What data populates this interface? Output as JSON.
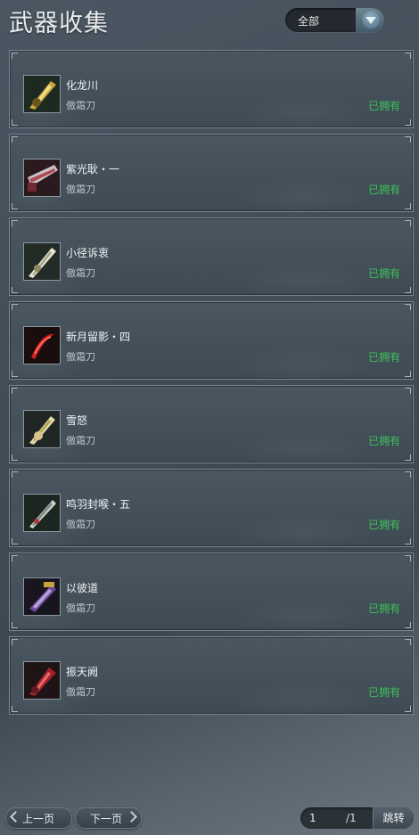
{
  "header": {
    "title": "武器收集"
  },
  "filter": {
    "selected": "全部"
  },
  "weapons": [
    {
      "name": "化龙川",
      "type": "傲霜刀",
      "status": "已拥有",
      "icon": "gold-blade-icon",
      "accent": "#c9a23a"
    },
    {
      "name": "紫光耿・一",
      "type": "傲霜刀",
      "status": "已拥有",
      "icon": "crimson-blade-icon",
      "accent": "#b04a56"
    },
    {
      "name": "小径诉衷",
      "type": "傲霜刀",
      "status": "已拥有",
      "icon": "silver-blade-icon",
      "accent": "#d8d3b8"
    },
    {
      "name": "新月留影・四",
      "type": "傲霜刀",
      "status": "已拥有",
      "icon": "red-crescent-blade-icon",
      "accent": "#d21f1f"
    },
    {
      "name": "雪怒",
      "type": "傲霜刀",
      "status": "已拥有",
      "icon": "snow-blade-icon",
      "accent": "#d6c68a"
    },
    {
      "name": "鸣羽封喉・五",
      "type": "傲霜刀",
      "status": "已拥有",
      "icon": "feather-blade-icon",
      "accent": "#cfd5d0"
    },
    {
      "name": "以彼道",
      "type": "傲霜刀",
      "status": "已拥有",
      "icon": "violet-blade-icon",
      "accent": "#6b4a9a"
    },
    {
      "name": "振天阙",
      "type": "傲霜刀",
      "status": "已拥有",
      "icon": "crimson-heavy-blade-icon",
      "accent": "#a3202a"
    }
  ],
  "pagination": {
    "prev_label": "上一页",
    "next_label": "下一页",
    "current_page": "1",
    "total_pages": "/1",
    "jump_label": "跳转"
  },
  "colors": {
    "owned": "#3cc257",
    "card_border": "#798691"
  }
}
